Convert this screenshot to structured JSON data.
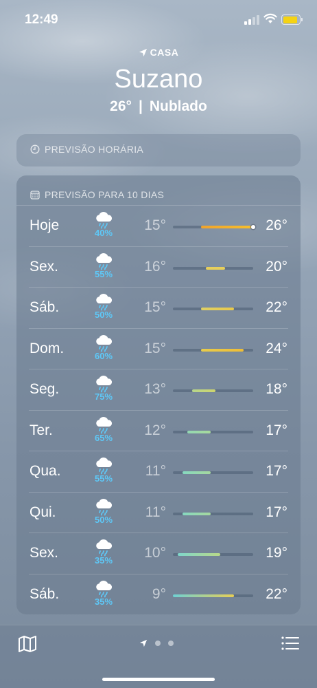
{
  "status": {
    "time": "12:49",
    "battery_color": "#f5d313"
  },
  "header": {
    "location_label": "CASA",
    "city": "Suzano",
    "current_temp": "26°",
    "separator": "|",
    "condition": "Nublado"
  },
  "hourly": {
    "title": "PREVISÃO HORÁRIA",
    "icon": "clock-icon"
  },
  "daily": {
    "title": "PREVISÃO PARA 10 DIAS",
    "icon": "calendar-icon",
    "scale_min": 9,
    "scale_max": 26,
    "rows": [
      {
        "day": "Hoje",
        "icon": "rain-cloud-icon",
        "precip": "40%",
        "low_text": "15°",
        "high_text": "26°",
        "low": 15,
        "high": 26,
        "current": 26,
        "color": "#f0a32c",
        "color2": "#f6c02c"
      },
      {
        "day": "Sex.",
        "icon": "rain-cloud-icon",
        "precip": "55%",
        "low_text": "16°",
        "high_text": "20°",
        "low": 16,
        "high": 20,
        "color": "#e7cf5b",
        "color2": "#e7cf5b"
      },
      {
        "day": "Sáb.",
        "icon": "rain-cloud-icon",
        "precip": "50%",
        "low_text": "15°",
        "high_text": "22°",
        "low": 15,
        "high": 22,
        "color": "#dfd065",
        "color2": "#e9c94a"
      },
      {
        "day": "Dom.",
        "icon": "rain-cloud-icon",
        "precip": "60%",
        "low_text": "15°",
        "high_text": "24°",
        "low": 15,
        "high": 24,
        "color": "#e7cc4c",
        "color2": "#efbd36"
      },
      {
        "day": "Seg.",
        "icon": "rain-cloud-icon",
        "precip": "75%",
        "low_text": "13°",
        "high_text": "18°",
        "low": 13,
        "high": 18,
        "color": "#b6d58b",
        "color2": "#cfd56d"
      },
      {
        "day": "Ter.",
        "icon": "rain-cloud-icon",
        "precip": "65%",
        "low_text": "12°",
        "high_text": "17°",
        "low": 12,
        "high": 17,
        "color": "#93d8b3",
        "color2": "#a8d99b"
      },
      {
        "day": "Qua.",
        "icon": "rain-cloud-icon",
        "precip": "55%",
        "low_text": "11°",
        "high_text": "17°",
        "low": 11,
        "high": 17,
        "color": "#86d8c0",
        "color2": "#a6d89e"
      },
      {
        "day": "Qui.",
        "icon": "rain-cloud-icon",
        "precip": "50%",
        "low_text": "11°",
        "high_text": "17°",
        "low": 11,
        "high": 17,
        "color": "#86d8c0",
        "color2": "#a6d89e"
      },
      {
        "day": "Sex.",
        "icon": "rain-cloud-icon",
        "precip": "35%",
        "low_text": "10°",
        "high_text": "19°",
        "low": 10,
        "high": 19,
        "color": "#7fd6cb",
        "color2": "#b9d888"
      },
      {
        "day": "Sáb.",
        "icon": "rain-cloud-icon",
        "precip": "35%",
        "low_text": "9°",
        "high_text": "22°",
        "low": 9,
        "high": 22,
        "color": "#6fd0d3",
        "color2": "#e7cf55"
      }
    ]
  },
  "bottom_bar": {
    "map_icon": "map-icon",
    "location_page_icon": "location-arrow-icon",
    "pages": 2,
    "list_icon": "list-icon"
  }
}
